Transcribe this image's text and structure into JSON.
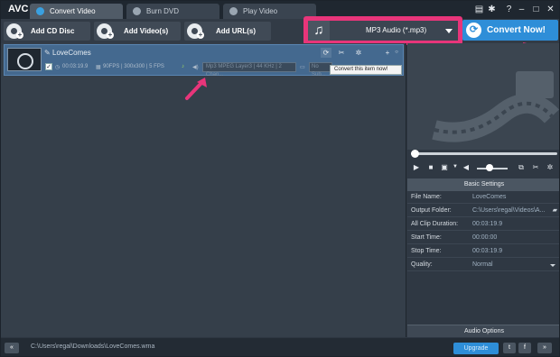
{
  "app": {
    "logo": "AVC"
  },
  "tabs": [
    {
      "label": "Convert Video",
      "active": true,
      "icon": "convert-icon"
    },
    {
      "label": "Burn DVD",
      "active": false,
      "icon": "dvd-icon"
    },
    {
      "label": "Play Video",
      "active": false,
      "icon": "play-icon"
    }
  ],
  "window_controls": [
    "grid-icon",
    "gear-icon",
    "help-icon",
    "minimize-icon",
    "maximize-icon",
    "close-icon"
  ],
  "window_glyphs": {
    "grid": "▤",
    "gear": "✱",
    "help": "?",
    "minimize": "–",
    "maximize": "□",
    "close": "✕"
  },
  "toolbar": {
    "add_cd": "Add CD Disc",
    "add_video": "Add Video(s)",
    "add_url": "Add URL(s)",
    "format": "MP3 Audio (*.mp3)",
    "convert_now": "Convert Now!"
  },
  "item": {
    "title": "LoveComes",
    "duration": "00:03:19.9",
    "video_info": "90FPS | 300x300 | 5 FPS",
    "profile": "Mp3 MPEG Layer3 | 44 KHz | 2 Chan...",
    "subtitle": "No Sub...",
    "tooltip": "Convert this item now!"
  },
  "settings": {
    "header": "Basic Settings",
    "rows": [
      {
        "key": "File Name:",
        "value": "LoveComes"
      },
      {
        "key": "Output Folder:",
        "value": "C:\\Users\\regal\\Videos\\A..."
      },
      {
        "key": "All Clip Duration:",
        "value": "00:03:19.9"
      },
      {
        "key": "Start Time:",
        "value": "00:00:00"
      },
      {
        "key": "Stop Time:",
        "value": "00:03:19.9"
      },
      {
        "key": "Quality:",
        "value": "Normal"
      }
    ],
    "audio_options": "Audio Options"
  },
  "status": {
    "path": "C:\\Users\\regal\\Downloads\\LoveComes.wma",
    "upgrade": "Upgrade",
    "collapse": "«",
    "expand": "»"
  },
  "colors": {
    "accent": "#2e8ed8",
    "highlight": "#e8357a",
    "selected_row": "#44698f"
  }
}
